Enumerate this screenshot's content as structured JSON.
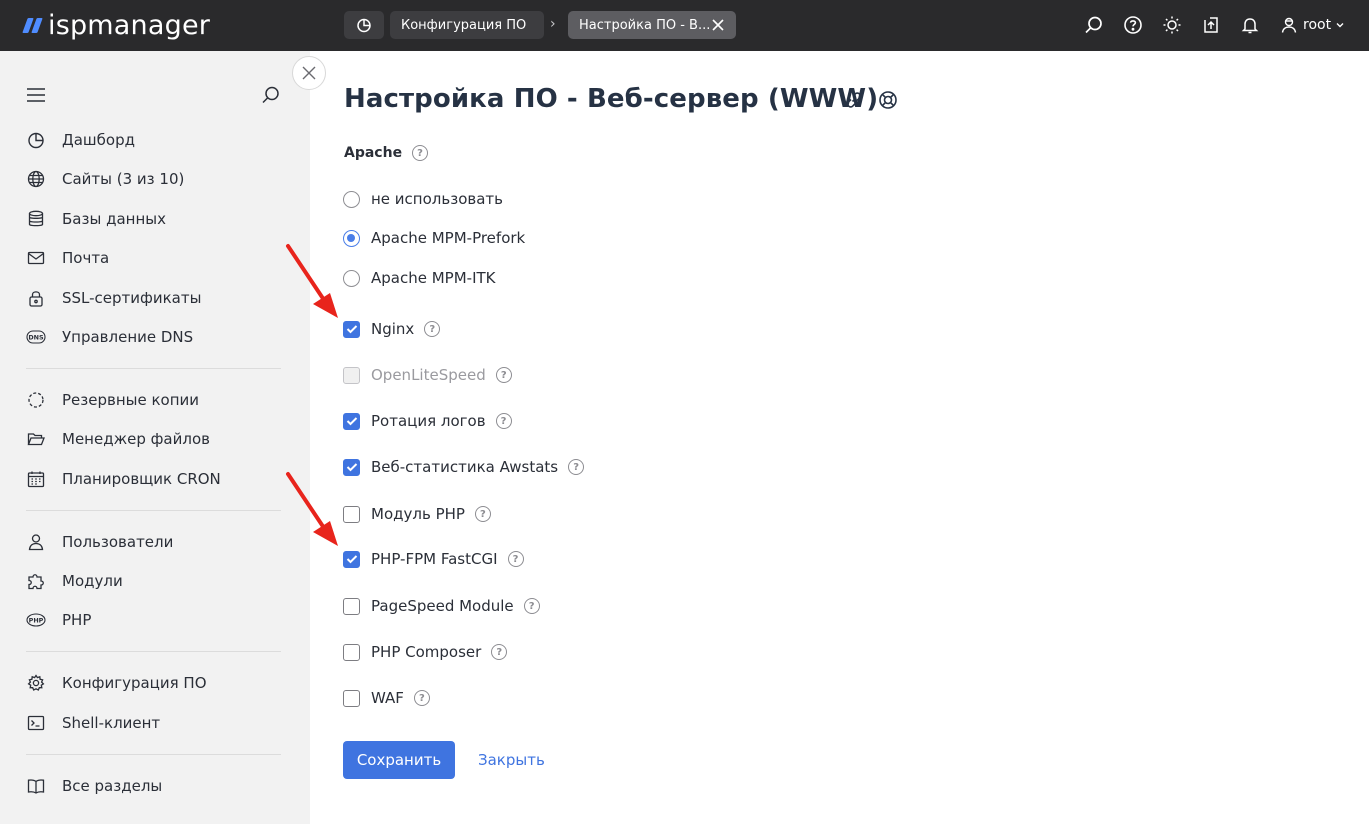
{
  "app": {
    "logo_text": "ispmanager"
  },
  "tabs": [
    {
      "label": "Конфигурация ПО"
    },
    {
      "label": "Настройка ПО - В..."
    }
  ],
  "header": {
    "user": "root"
  },
  "sidebar": {
    "items": [
      {
        "label": "Дашборд",
        "icon": "dashboard-icon"
      },
      {
        "label": "Сайты (3 из 10)",
        "icon": "globe-icon"
      },
      {
        "label": "Базы данных",
        "icon": "database-icon"
      },
      {
        "label": "Почта",
        "icon": "mail-icon"
      },
      {
        "label": "SSL-сертификаты",
        "icon": "lock-icon"
      },
      {
        "label": "Управление DNS",
        "icon": "dns-icon"
      },
      {
        "label": "Резервные копии",
        "icon": "backup-icon"
      },
      {
        "label": "Менеджер файлов",
        "icon": "folder-icon"
      },
      {
        "label": "Планировщик CRON",
        "icon": "calendar-icon"
      },
      {
        "label": "Пользователи",
        "icon": "user-icon"
      },
      {
        "label": "Модули",
        "icon": "puzzle-icon"
      },
      {
        "label": "PHP",
        "icon": "php-icon"
      },
      {
        "label": "Конфигурация ПО",
        "icon": "gear-icon"
      },
      {
        "label": "Shell-клиент",
        "icon": "terminal-icon"
      },
      {
        "label": "Все разделы",
        "icon": "book-icon"
      }
    ]
  },
  "main": {
    "title": "Настройка ПО - Веб-сервер (WWW)",
    "section_label": "Apache",
    "help_glyph": "?",
    "radios": [
      {
        "label": "не использовать",
        "checked": false
      },
      {
        "label": "Apache MPM-Prefork",
        "checked": true
      },
      {
        "label": "Apache MPM-ITK",
        "checked": false
      }
    ],
    "checkboxes": [
      {
        "label": "Nginx",
        "checked": true,
        "disabled": false
      },
      {
        "label": "OpenLiteSpeed",
        "checked": false,
        "disabled": true
      },
      {
        "label": "Ротация логов",
        "checked": true,
        "disabled": false
      },
      {
        "label": "Веб-статистика Awstats",
        "checked": true,
        "disabled": false
      },
      {
        "label": "Модуль PHP",
        "checked": false,
        "disabled": false
      },
      {
        "label": "PHP-FPM FastCGI",
        "checked": true,
        "disabled": false
      },
      {
        "label": "PageSpeed Module",
        "checked": false,
        "disabled": false
      },
      {
        "label": "PHP Composer",
        "checked": false,
        "disabled": false
      },
      {
        "label": "WAF",
        "checked": false,
        "disabled": false
      }
    ],
    "save_label": "Сохранить",
    "close_label": "Закрыть"
  },
  "colors": {
    "accent": "#3f74e0",
    "topbar": "#2a2a2c",
    "sidebar": "#f2f2f2",
    "annotation_arrow": "#e8241c"
  }
}
